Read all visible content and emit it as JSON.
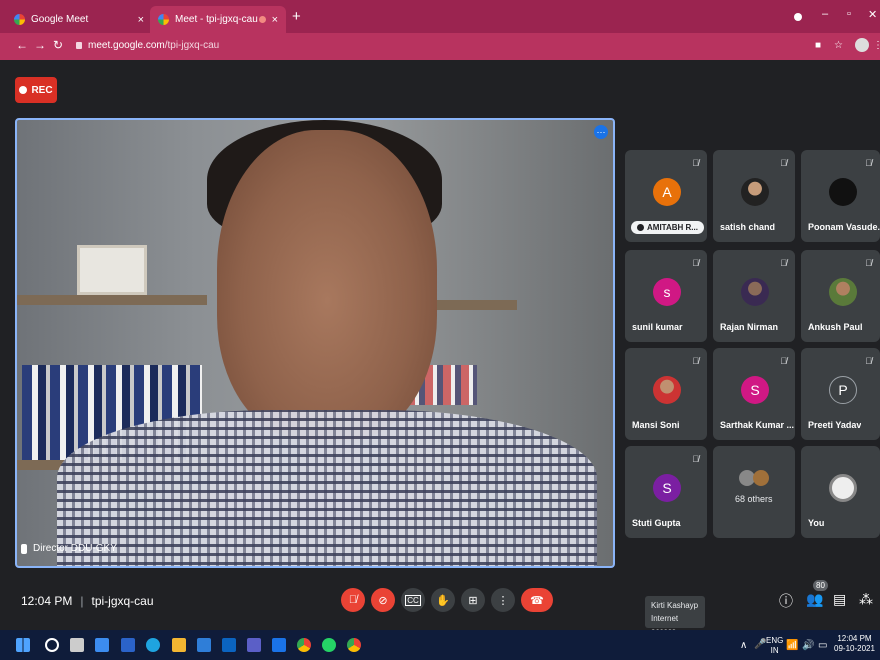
{
  "browser": {
    "tabs": [
      {
        "title": "Google Meet",
        "close": "×"
      },
      {
        "title": "Meet - tpi-jgxq-cau",
        "close": "×"
      }
    ],
    "new_tab": "+",
    "url_host": "meet.google.com",
    "url_path": "/tpi-jgxq-cau"
  },
  "recording": {
    "label": "REC"
  },
  "main_video": {
    "label": "Director DDU-GKY",
    "more": "⋯"
  },
  "participants": [
    {
      "name": "AMITABH R...",
      "initial": "A",
      "color": "#e8710a",
      "type": "letter"
    },
    {
      "name": "satish chand",
      "type": "photo"
    },
    {
      "name": "Poonam Vasude...",
      "type": "photo"
    },
    {
      "name": "sunil kumar",
      "initial": "s",
      "color": "#d01884",
      "type": "letter"
    },
    {
      "name": "Rajan Nirman",
      "type": "photo"
    },
    {
      "name": "Ankush Paul",
      "type": "photo"
    },
    {
      "name": "Mansi Soni",
      "type": "photo"
    },
    {
      "name": "Sarthak Kumar ...",
      "initial": "S",
      "color": "#d01884",
      "type": "letter"
    },
    {
      "name": "Preeti Yadav",
      "initial": "P",
      "color": "#3c4043",
      "type": "letter"
    },
    {
      "name": "Stuti Gupta",
      "initial": "S",
      "color": "#7b1fa2",
      "type": "letter"
    },
    {
      "name": "68 others",
      "type": "others"
    },
    {
      "name": "You",
      "type": "photo"
    }
  ],
  "bottom_bar": {
    "time": "12:04 PM",
    "separator": "|",
    "meeting_code": "tpi-jgxq-cau",
    "participant_count": "80",
    "tooltip_name": "Kirti Kashayp",
    "tooltip_status": "Internet access"
  },
  "taskbar": {
    "lang_top": "ENG",
    "lang_bottom": "IN",
    "clock_time": "12:04 PM",
    "clock_date": "09-10-2021"
  }
}
